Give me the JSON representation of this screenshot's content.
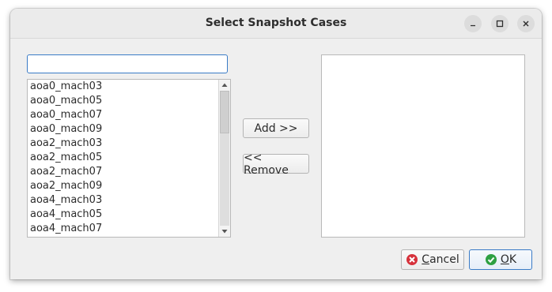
{
  "window": {
    "title": "Select Snapshot Cases"
  },
  "titlebar_buttons": {
    "minimize_icon": "minimize-icon",
    "maximize_icon": "maximize-icon",
    "close_icon": "close-icon"
  },
  "search": {
    "value": "",
    "placeholder": ""
  },
  "available_list": {
    "items": [
      "aoa0_mach03",
      "aoa0_mach05",
      "aoa0_mach07",
      "aoa0_mach09",
      "aoa2_mach03",
      "aoa2_mach05",
      "aoa2_mach07",
      "aoa2_mach09",
      "aoa4_mach03",
      "aoa4_mach05",
      "aoa4_mach07"
    ]
  },
  "actions": {
    "add_label": "Add >>",
    "remove_label": "<< Remove"
  },
  "selected_list": {
    "items": []
  },
  "footer": {
    "cancel_label": "Cancel",
    "ok_label": "OK"
  },
  "colors": {
    "focus_border": "#3a7bc6",
    "cancel_icon": "#d6313b",
    "ok_icon": "#2ea043"
  }
}
